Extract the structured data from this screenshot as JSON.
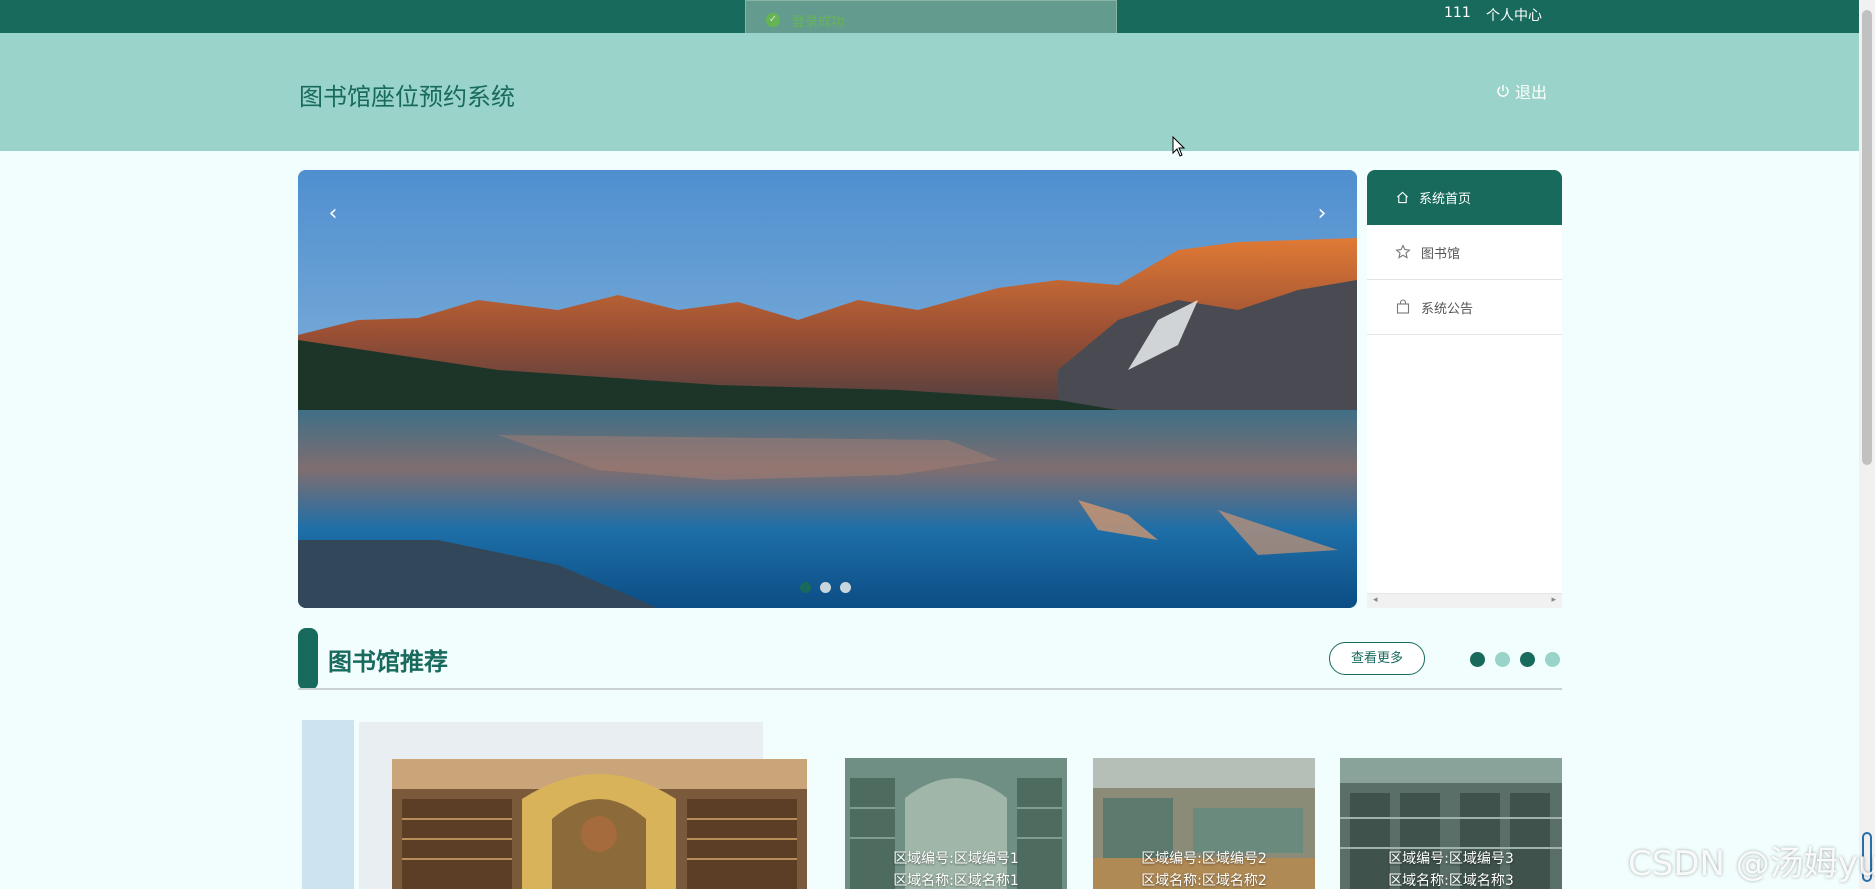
{
  "topbar": {
    "username": "111",
    "personal_center": "个人中心"
  },
  "toast": {
    "message": "登录成功"
  },
  "header": {
    "title": "图书馆座位预约系统",
    "logout_label": "退出"
  },
  "carousel": {
    "slide_count": 3,
    "active_index": 0,
    "prev_label": "‹",
    "next_label": "›"
  },
  "sidebar": {
    "items": [
      {
        "label": "系统首页",
        "icon": "home-icon",
        "active": true
      },
      {
        "label": "图书馆",
        "icon": "star-icon",
        "active": false
      },
      {
        "label": "系统公告",
        "icon": "bag-icon",
        "active": false
      }
    ]
  },
  "recommend": {
    "title": "图书馆推荐",
    "more_label": "查看更多",
    "dot_colors": [
      "#176a5c",
      "#9ad3c9",
      "#176a5c",
      "#9ad3c9"
    ],
    "cards": [
      {
        "line1": "区域编号:区域编号1",
        "line2": "区域名称:区域名称1"
      },
      {
        "line1": "区域编号:区域编号2",
        "line2": "区域名称:区域名称2"
      },
      {
        "line1": "区域编号:区域编号3",
        "line2": "区域名称:区域名称3"
      }
    ]
  },
  "watermark": "CSDN @汤姆yu",
  "colors": {
    "primary": "#176a5c",
    "header_bg": "#9ad3c9",
    "page_bg": "#f2fdfd"
  }
}
